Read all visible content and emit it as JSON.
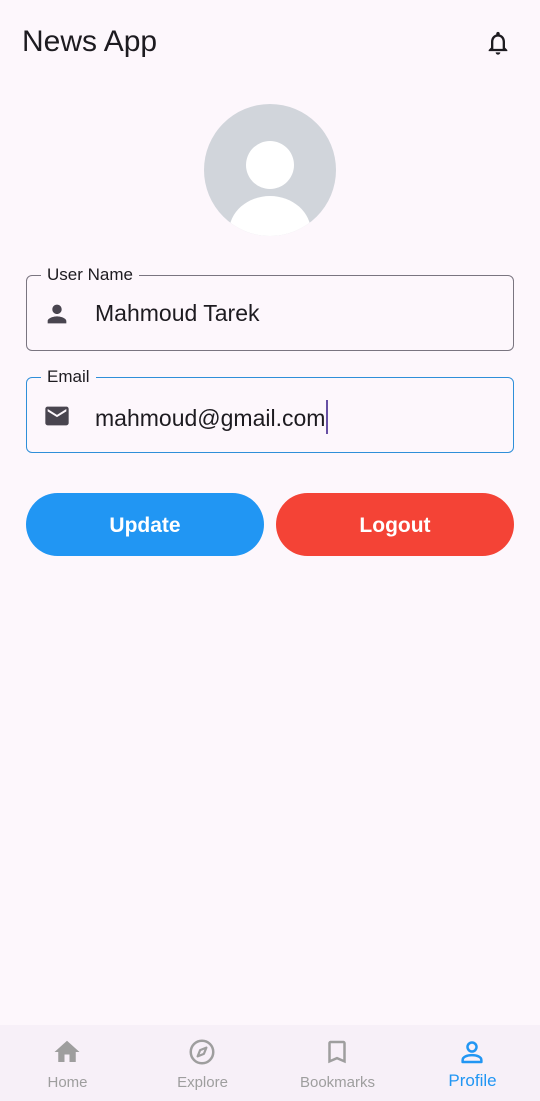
{
  "app_bar": {
    "title": "News App",
    "notification_icon": "bell-icon"
  },
  "profile": {
    "avatar_icon": "person-avatar-icon",
    "username_field": {
      "label": "User Name",
      "value": "Mahmoud Tarek",
      "icon": "person-icon"
    },
    "email_field": {
      "label": "Email",
      "value": "mahmoud@gmail.com",
      "icon": "mail-icon",
      "focused": true
    },
    "update_button": "Update",
    "logout_button": "Logout"
  },
  "bottom_nav": {
    "items": [
      {
        "label": "Home",
        "icon": "home-icon",
        "active": false
      },
      {
        "label": "Explore",
        "icon": "compass-icon",
        "active": false
      },
      {
        "label": "Bookmarks",
        "icon": "bookmark-icon",
        "active": false
      },
      {
        "label": "Profile",
        "icon": "person-outline-icon",
        "active": true
      }
    ]
  },
  "colors": {
    "background": "#fdf7fc",
    "update": "#2196f3",
    "logout": "#f44336",
    "active_nav": "#2196f3",
    "inactive_nav": "#9e9e9e",
    "focused_border": "#2f8fd9"
  }
}
